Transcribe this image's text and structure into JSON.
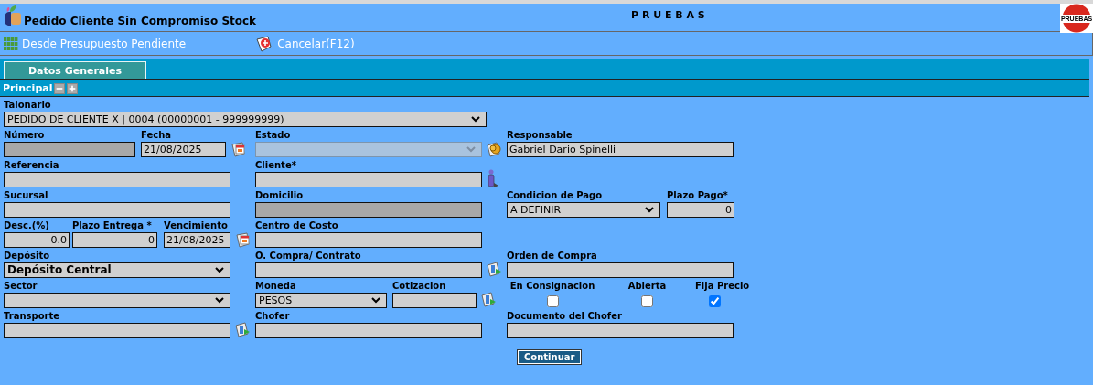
{
  "window": {
    "title": "Pedido Cliente Sin Compromiso Stock",
    "environment": "P R U E B A S",
    "badge": "PRUEBAS"
  },
  "toolbar": [
    {
      "kind": "grid",
      "label": "Desde Presupuesto Pendiente"
    },
    {
      "kind": "cancel",
      "label": "Cancelar(F12)"
    }
  ],
  "tabs": [
    {
      "label": "Datos Generales",
      "selected": true
    }
  ],
  "section": {
    "title": "Principal"
  },
  "rows": [
    [
      {
        "label": "Talonario",
        "kind": "select",
        "value": "PEDIDO DE CLIENTE X | 0004 (00000001 - 999999999)",
        "disabled": false
      }
    ],
    [
      {
        "label": "Número",
        "kind": "text",
        "disabled": true
      },
      {
        "label": "Fecha",
        "kind": "text",
        "value": "21/08/2025",
        "disabled": false,
        "icon": {
          "kind": "calendar"
        }
      },
      {
        "label": "Estado",
        "kind": "select",
        "disabled": true,
        "icon": {
          "kind": "coin"
        }
      },
      {
        "label": "Responsable",
        "kind": "text",
        "value": "Gabriel Dario Spinelli",
        "disabled": false
      }
    ],
    [
      {
        "label": "Referencia",
        "kind": "text",
        "disabled": false
      },
      {
        "label": "Cliente*",
        "kind": "text",
        "disabled": false,
        "icon": {
          "kind": "person"
        }
      }
    ],
    [
      {
        "label": "Sucursal",
        "kind": "text",
        "disabled": false
      },
      {
        "label": "Domicilio",
        "kind": "text",
        "disabled": true
      },
      {
        "label": "Condicion de Pago",
        "kind": "select",
        "value": "A DEFINIR",
        "disabled": false
      },
      {
        "label": "Plazo Pago*",
        "kind": "number",
        "value": "0",
        "disabled": false
      }
    ],
    [
      {
        "label": "Desc.(%)",
        "kind": "number",
        "value": "0.0",
        "disabled": false
      },
      {
        "label": "Plazo Entrega *",
        "kind": "number",
        "value": "0",
        "disabled": false
      },
      {
        "label": "Vencimiento",
        "kind": "text",
        "value": "21/08/2025",
        "disabled": false,
        "icon": {
          "kind": "calendar"
        }
      },
      {
        "label": "Centro de Costo",
        "kind": "text",
        "disabled": false
      }
    ],
    [
      {
        "label": "Depósito",
        "kind": "select",
        "value": "Depósito Central",
        "bold": true,
        "disabled": false
      },
      {
        "label": "O. Compra/ Contrato",
        "kind": "text",
        "disabled": false,
        "icon": {
          "kind": "lookup"
        }
      },
      {
        "label": "Orden de Compra",
        "kind": "text",
        "disabled": false
      }
    ],
    [
      {
        "label": "Sector",
        "kind": "select",
        "disabled": false
      },
      {
        "label": "Moneda",
        "kind": "select",
        "value": "PESOS",
        "disabled": false
      },
      {
        "label": "Cotizacion",
        "kind": "text",
        "disabled": false,
        "icon": {
          "kind": "lookup"
        }
      },
      {
        "label": "En Consignacion",
        "kind": "checkbox",
        "checked": false
      },
      {
        "label": "Abierta",
        "kind": "checkbox",
        "checked": false
      },
      {
        "label": "Fija Precio",
        "kind": "checkbox",
        "checked": true
      }
    ],
    [
      {
        "label": "Transporte",
        "kind": "text",
        "disabled": false,
        "icon": {
          "kind": "lookup"
        }
      },
      {
        "label": "Chofer",
        "kind": "text",
        "disabled": false
      },
      {
        "label": "Documento del Chofer",
        "kind": "text",
        "disabled": false
      }
    ]
  ],
  "button": "Continuar"
}
